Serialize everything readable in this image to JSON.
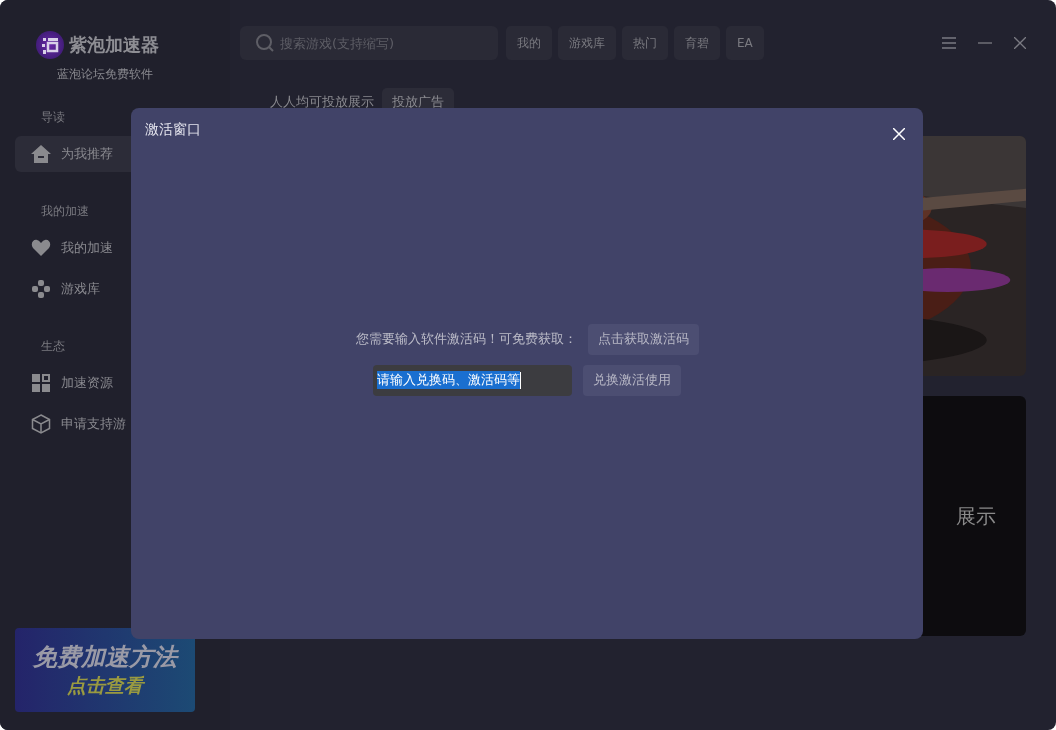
{
  "app": {
    "name": "紫泡加速器",
    "subtitle": "蓝泡论坛免费软件"
  },
  "search": {
    "placeholder": "搜索游戏(支持缩写)"
  },
  "tabs": [
    {
      "label": "我的",
      "selected": false
    },
    {
      "label": "游戏库",
      "selected": false
    },
    {
      "label": "热门",
      "selected": false
    },
    {
      "label": "育碧",
      "selected": false
    },
    {
      "label": "EA",
      "selected": false
    }
  ],
  "sidebar": {
    "groups": [
      {
        "title": "导读",
        "items": [
          {
            "label": "为我推荐",
            "kind": "home",
            "selected": true
          }
        ]
      },
      {
        "title": "我的加速",
        "items": [
          {
            "label": "我的加速",
            "kind": "heart",
            "selected": false
          },
          {
            "label": "游戏库",
            "kind": "gamepad",
            "selected": false
          }
        ]
      },
      {
        "title": "生态",
        "items": [
          {
            "label": "加速资源",
            "kind": "grid",
            "selected": false
          },
          {
            "label": "申请支持游",
            "kind": "cube",
            "selected": false
          }
        ]
      }
    ]
  },
  "promo_banner": {
    "title": "免费加速方法",
    "subtitle": "点击查看"
  },
  "ad_bar": {
    "text": "人人均可投放展示",
    "button": "投放广告"
  },
  "cards": [
    {
      "kind": "picture"
    },
    {
      "kind": "text",
      "text": "展示"
    }
  ],
  "dialog": {
    "title": "激活窗口",
    "message": "您需要输入软件激活码！可免费获取：",
    "get_code_button": "点击获取激活码",
    "code_field": {
      "value": "请输入兑换码、激活码等",
      "text_selected": true
    },
    "redeem_button": "兑换激活使用"
  }
}
